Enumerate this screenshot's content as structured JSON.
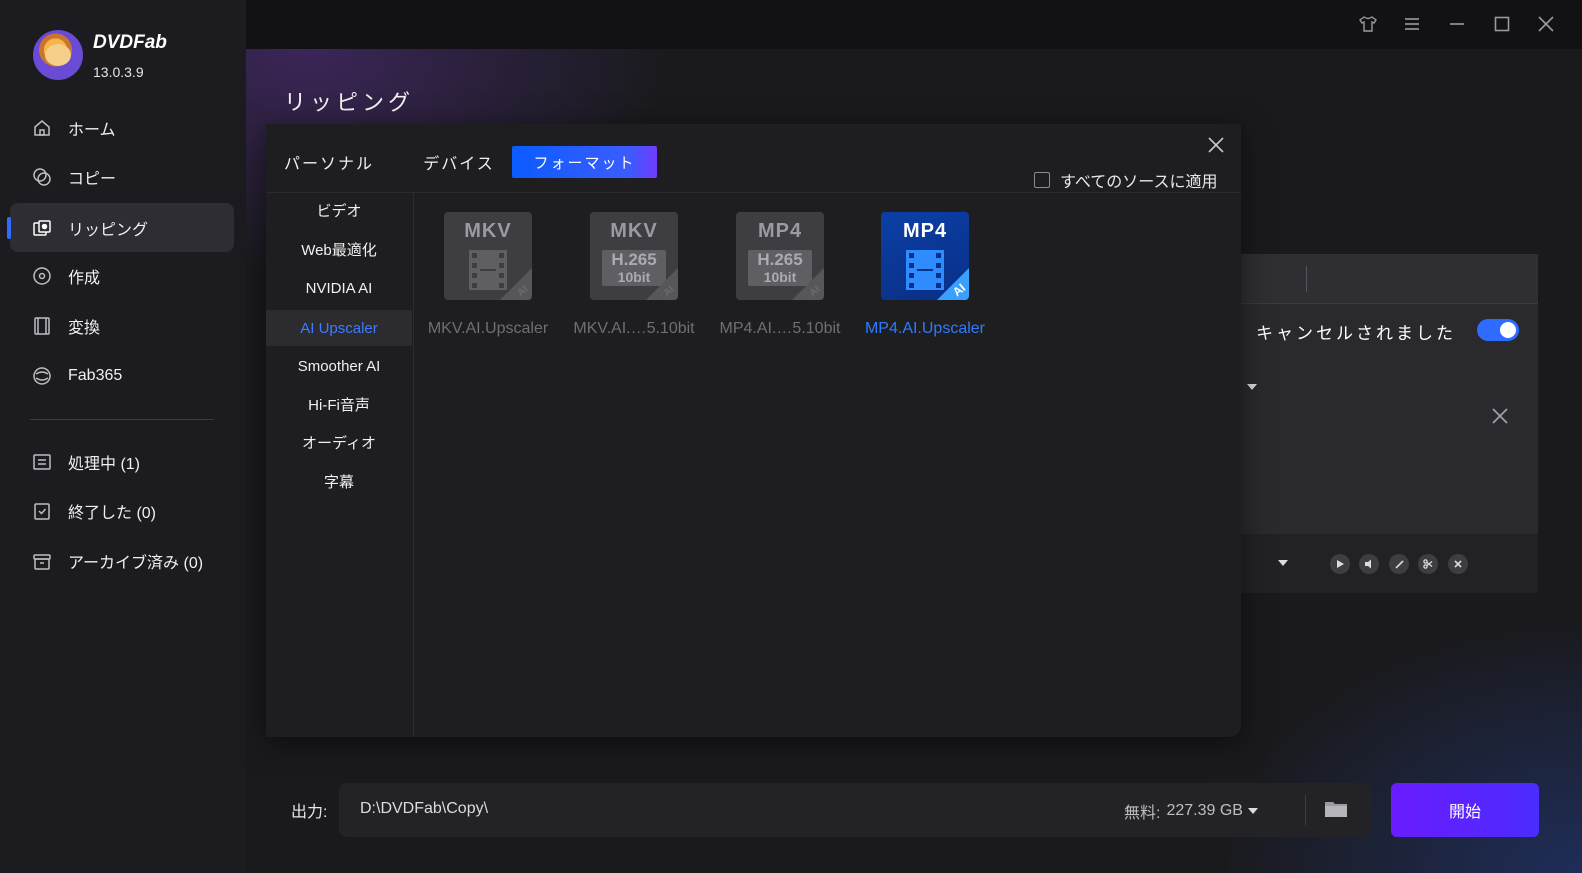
{
  "app": {
    "brand": "DVDFab",
    "version": "13.0.3.9"
  },
  "sidebar": {
    "items": [
      {
        "label": "ホーム",
        "icon": "home-icon"
      },
      {
        "label": "コピー",
        "icon": "copy-icon"
      },
      {
        "label": "リッピング",
        "icon": "ripper-icon",
        "active": true
      },
      {
        "label": "作成",
        "icon": "creator-icon"
      },
      {
        "label": "変換",
        "icon": "converter-icon"
      },
      {
        "label": "Fab365",
        "icon": "fab365-icon"
      }
    ],
    "queue": [
      {
        "label": "処理中 (1)",
        "icon": "processing-icon"
      },
      {
        "label": "終了した (0)",
        "icon": "finished-icon"
      },
      {
        "label": "アーカイブ済み (0)",
        "icon": "archive-icon"
      }
    ]
  },
  "titlebar": {
    "icons": [
      "shirt-icon",
      "menu-icon",
      "minimize-icon",
      "maximize-icon",
      "close-icon"
    ]
  },
  "main": {
    "title": "リッピング"
  },
  "task": {
    "status_text": "キャンセルされました",
    "toggle_on": true
  },
  "profile_dialog": {
    "tabs": [
      {
        "label": "パーソナル"
      },
      {
        "label": "デバイス"
      },
      {
        "label": "フォーマット",
        "active": true
      }
    ],
    "apply_all_label": "すべてのソースに適用",
    "categories": [
      {
        "label": "ビデオ"
      },
      {
        "label": "Web最適化"
      },
      {
        "label": "NVIDIA AI"
      },
      {
        "label": "AI Upscaler",
        "active": true
      },
      {
        "label": "Smoother AI"
      },
      {
        "label": "Hi-Fi音声"
      },
      {
        "label": "オーディオ"
      },
      {
        "label": "字幕"
      }
    ],
    "formats": [
      {
        "label": "MKV.AI.Upscaler",
        "badge": "MKV",
        "codec": "",
        "bitdepth": "",
        "ai": "AI",
        "active": false
      },
      {
        "label": "MKV.AI.…5.10bit",
        "badge": "MKV",
        "codec": "H.265",
        "bitdepth": "10bit",
        "ai": "AI",
        "active": false
      },
      {
        "label": "MP4.AI.…5.10bit",
        "badge": "MP4",
        "codec": "H.265",
        "bitdepth": "10bit",
        "ai": "AI",
        "active": false
      },
      {
        "label": "MP4.AI.Upscaler",
        "badge": "MP4",
        "codec": "",
        "bitdepth": "",
        "ai": "AI",
        "active": true
      }
    ]
  },
  "output": {
    "label": "出力:",
    "path": "D:\\DVDFab\\Copy\\",
    "free_label": "無料:",
    "free_value": "227.39 GB",
    "start_label": "開始"
  },
  "colors": {
    "accent": "#2f6bff",
    "start_gradient": "#6a1cff"
  }
}
